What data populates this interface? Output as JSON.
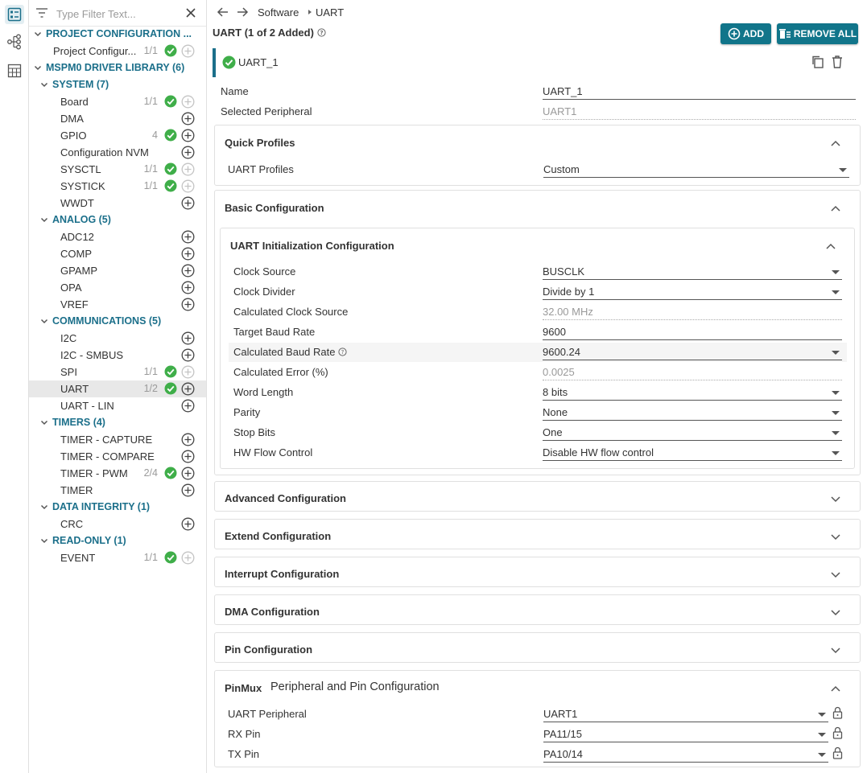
{
  "filter": {
    "placeholder": "Type Filter Text..."
  },
  "tree": {
    "project": {
      "label": "PROJECT CONFIGURATION ...",
      "item_label": "Project Configur...",
      "item_count": "1/1"
    },
    "library": {
      "label": "MSPM0 DRIVER LIBRARY (6)"
    },
    "groups": {
      "system": {
        "label": "SYSTEM (7)",
        "items": [
          {
            "label": "Board",
            "count": "1/1"
          },
          {
            "label": "DMA",
            "count": ""
          },
          {
            "label": "GPIO",
            "count": "4"
          },
          {
            "label": "Configuration NVM",
            "count": ""
          },
          {
            "label": "SYSCTL",
            "count": "1/1"
          },
          {
            "label": "SYSTICK",
            "count": "1/1"
          },
          {
            "label": "WWDT",
            "count": ""
          }
        ]
      },
      "analog": {
        "label": "ANALOG (5)",
        "items": [
          {
            "label": "ADC12",
            "count": ""
          },
          {
            "label": "COMP",
            "count": ""
          },
          {
            "label": "GPAMP",
            "count": ""
          },
          {
            "label": "OPA",
            "count": ""
          },
          {
            "label": "VREF",
            "count": ""
          }
        ]
      },
      "communications": {
        "label": "COMMUNICATIONS (5)",
        "items": [
          {
            "label": "I2C",
            "count": ""
          },
          {
            "label": "I2C - SMBUS",
            "count": ""
          },
          {
            "label": "SPI",
            "count": "1/1"
          },
          {
            "label": "UART",
            "count": "1/2"
          },
          {
            "label": "UART - LIN",
            "count": ""
          }
        ]
      },
      "timers": {
        "label": "TIMERS (4)",
        "items": [
          {
            "label": "TIMER - CAPTURE",
            "count": ""
          },
          {
            "label": "TIMER - COMPARE",
            "count": ""
          },
          {
            "label": "TIMER - PWM",
            "count": "2/4"
          },
          {
            "label": "TIMER",
            "count": ""
          }
        ]
      },
      "integrity": {
        "label": "DATA INTEGRITY (1)",
        "items": [
          {
            "label": "CRC",
            "count": ""
          }
        ]
      },
      "readonly": {
        "label": "READ-ONLY (1)",
        "items": [
          {
            "label": "EVENT",
            "count": "1/1"
          }
        ]
      }
    }
  },
  "breadcrumb": {
    "root": "Software",
    "current": "UART"
  },
  "module": {
    "title": "UART (1 of 2 Added)",
    "add_label": "ADD",
    "remove_all_label": "REMOVE ALL"
  },
  "instance": {
    "label": "UART_1",
    "name_label": "Name",
    "name_value": "UART_1",
    "peripheral_label": "Selected Peripheral",
    "peripheral_value": "UART1"
  },
  "quick_profiles": {
    "title": "Quick Profiles",
    "profile_label": "UART Profiles",
    "profile_value": "Custom"
  },
  "basic": {
    "title": "Basic Configuration",
    "init_title": "UART Initialization Configuration",
    "clock_source_label": "Clock Source",
    "clock_source_value": "BUSCLK",
    "clock_divider_label": "Clock Divider",
    "clock_divider_value": "Divide by 1",
    "calc_clock_label": "Calculated Clock Source",
    "calc_clock_value": "32.00 MHz",
    "target_baud_label": "Target Baud Rate",
    "target_baud_value": "9600",
    "calc_baud_label": "Calculated Baud Rate",
    "calc_baud_value": "9600.24",
    "calc_error_label": "Calculated Error (%)",
    "calc_error_value": "0.0025",
    "word_length_label": "Word Length",
    "word_length_value": "8 bits",
    "parity_label": "Parity",
    "parity_value": "None",
    "stop_bits_label": "Stop Bits",
    "stop_bits_value": "One",
    "hw_flow_label": "HW Flow Control",
    "hw_flow_value": "Disable HW flow control"
  },
  "sections": {
    "advanced": "Advanced Configuration",
    "extend": "Extend Configuration",
    "interrupt": "Interrupt Configuration",
    "dma": "DMA Configuration",
    "pin": "Pin Configuration"
  },
  "pinmux": {
    "tag": "PinMux",
    "title": "Peripheral and Pin Configuration",
    "uart_periph_label": "UART Peripheral",
    "uart_periph_value": "UART1",
    "rx_label": "RX Pin",
    "rx_value": "PA11/15",
    "tx_label": "TX Pin",
    "tx_value": "PA10/14"
  },
  "colors": {
    "accent": "#1b6f8a",
    "button": "#11758a",
    "check": "#3fae49"
  }
}
